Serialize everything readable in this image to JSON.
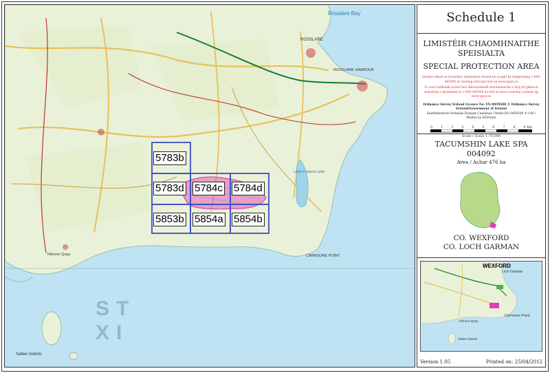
{
  "map": {
    "labels": {
      "rosslare_bay": "Rosslare Bay",
      "rosslare": "ROSSLARE",
      "harbour": "ROSSLARE HARBOUR",
      "carnsore": "CARNSORE POINT",
      "kilmore": "Kilmore Quay",
      "saltee": "Saltee Islands",
      "lady_lake": "Lady's Island Lake"
    },
    "sea_letters": [
      "S",
      "T",
      "X",
      "I"
    ],
    "grid_tiles": [
      "5783b",
      "5783d",
      "5784c",
      "5784d",
      "5853b",
      "5854a",
      "5854b"
    ],
    "accent_color": "#3b4fc4",
    "spa_color": "#e040b0"
  },
  "panel": {
    "schedule": "Schedule 1",
    "irish_title_1": "LIMISTÉIR CHAOMHNAITHE",
    "irish_title_2": "SPEISIALTA",
    "english_title": "SPECIAL PROTECTION AREA",
    "notice_en": "Greater detail on boundary delineation should be sought by telephoning 1-800-405000 or viewing relevant text on www.npws.ie",
    "notice_ga": "Is ceart tuilleadh sonraí faoi dhíscaoileadh teorainneacha a lorg trí ghlaoch teileafóin a dhéanamh ar 1-800-405000 nó tríd an téacs iomchuí a léamh ag www.npws.ie",
    "licence": "Ordnance Survey Ireland Licence No. EN 0059208 © Ordnance Survey Ireland/Government of Ireland",
    "licence_ga": "Suirbhéireacht Ordanáis Éireann Ceadúnas Uimhir EN 0059208 © OSI / Rialtas na hÉireann",
    "scale_ticks": [
      "0",
      "1",
      "2",
      "3",
      "4",
      "5",
      "6",
      "7",
      "8",
      "9 km"
    ],
    "scale_text": "Scale / Scála 1:70,000",
    "site_name": "TACUMSHIN LAKE SPA",
    "site_code": "004092",
    "area": "Area / Achar 476 ha",
    "county_en": "CO. WEXFORD",
    "county_ga": "CO. LOCH GARMAN",
    "inset_labels": {
      "wexford": "WEXFORD",
      "loch_garman": "Loch Garman",
      "carnsore": "Carnsore Point",
      "kilmore": "Kilmore Quay",
      "saltee": "Saltee Islands"
    },
    "version": "Version 1.05",
    "printed": "Printed on: 25/04/2012"
  }
}
